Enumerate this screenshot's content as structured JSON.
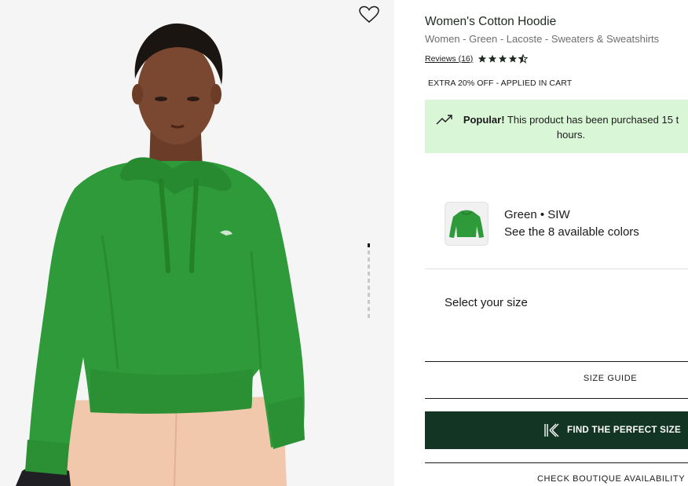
{
  "product": {
    "title": "Women's Cotton Hoodie",
    "breadcrumb": "Women - Green - Lacoste - Sweaters & Sweatshirts",
    "reviews_label": "Reviews (16)",
    "rating": 4.5,
    "promo": "EXTRA 20% OFF - APPLIED IN CART"
  },
  "popular": {
    "strong": "Popular!",
    "line1": " This product has been purchased 15 t",
    "line2": "hours."
  },
  "color": {
    "name": "Green • SIW",
    "available": "See the 8 available colors"
  },
  "size": {
    "label": "Select your size",
    "guide": "SIZE GUIDE"
  },
  "actions": {
    "find_size": "FIND THE PERFECT SIZE",
    "boutique": "CHECK BOUTIQUE AVAILABILITY"
  },
  "gallery": {
    "image_count": 10,
    "active_index": 0
  },
  "colors": {
    "hoodie_green": "#2f9a3a",
    "popular_bg": "#d9f7d6",
    "button_bg": "#123524",
    "pants_peach": "#f2c8ad"
  },
  "icons": {
    "wishlist": "heart-outline-icon",
    "trend": "trending-up-icon",
    "find_size": "k-logo-icon",
    "star": "star-icon"
  }
}
